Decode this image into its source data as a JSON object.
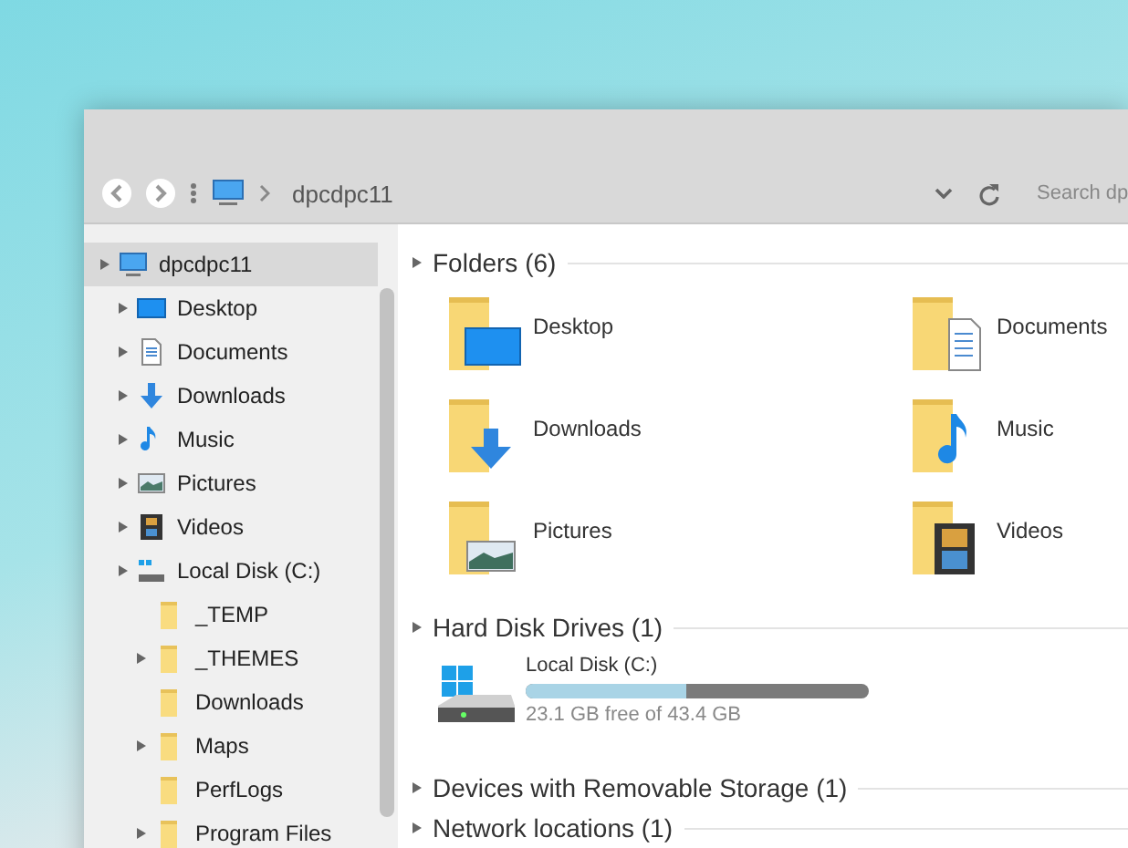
{
  "toolbar": {
    "path": "dpcdpc11",
    "search": {
      "placeholder": "Search dp"
    }
  },
  "sidebar": {
    "items": [
      {
        "label": "dpcdpc11",
        "kind": "computer",
        "expandable": true,
        "selected": true,
        "children": [
          {
            "label": "Desktop",
            "kind": "desktop",
            "expandable": true,
            "selected": false
          },
          {
            "label": "Documents",
            "kind": "documents",
            "expandable": true,
            "selected": false
          },
          {
            "label": "Downloads",
            "kind": "downloads",
            "expandable": true,
            "selected": false
          },
          {
            "label": "Music",
            "kind": "music",
            "expandable": true,
            "selected": false
          },
          {
            "label": "Pictures",
            "kind": "pictures",
            "expandable": true,
            "selected": false
          },
          {
            "label": "Videos",
            "kind": "videos",
            "expandable": true,
            "selected": false
          },
          {
            "label": "Local Disk (C:)",
            "kind": "drive",
            "expandable": true,
            "selected": false,
            "children": [
              {
                "label": "_TEMP",
                "kind": "folder",
                "expandable": false,
                "selected": false
              },
              {
                "label": "_THEMES",
                "kind": "folder",
                "expandable": true,
                "selected": false
              },
              {
                "label": "Downloads",
                "kind": "folder",
                "expandable": false,
                "selected": false
              },
              {
                "label": "Maps",
                "kind": "folder",
                "expandable": true,
                "selected": false
              },
              {
                "label": "PerfLogs",
                "kind": "folder",
                "expandable": false,
                "selected": false
              },
              {
                "label": "Program Files",
                "kind": "folder",
                "expandable": true,
                "selected": false
              }
            ]
          }
        ]
      }
    ]
  },
  "groups": [
    {
      "title": "Folders (6)",
      "kind": "folders",
      "items": [
        {
          "label": "Desktop",
          "kind": "desktop"
        },
        {
          "label": "Documents",
          "kind": "documents"
        },
        {
          "label": "Downloads",
          "kind": "downloads"
        },
        {
          "label": "Music",
          "kind": "music"
        },
        {
          "label": "Pictures",
          "kind": "pictures"
        },
        {
          "label": "Videos",
          "kind": "videos"
        }
      ]
    },
    {
      "title": "Hard Disk Drives (1)",
      "kind": "drives",
      "items": [
        {
          "label": "Local Disk (C:)",
          "level": 0.47,
          "free": "23.1 GB free of 43.4 GB"
        }
      ]
    },
    {
      "title": "Devices with Removable Storage (1)",
      "kind": "collapsed"
    },
    {
      "title": "Network locations (1)",
      "kind": "collapsed"
    }
  ]
}
